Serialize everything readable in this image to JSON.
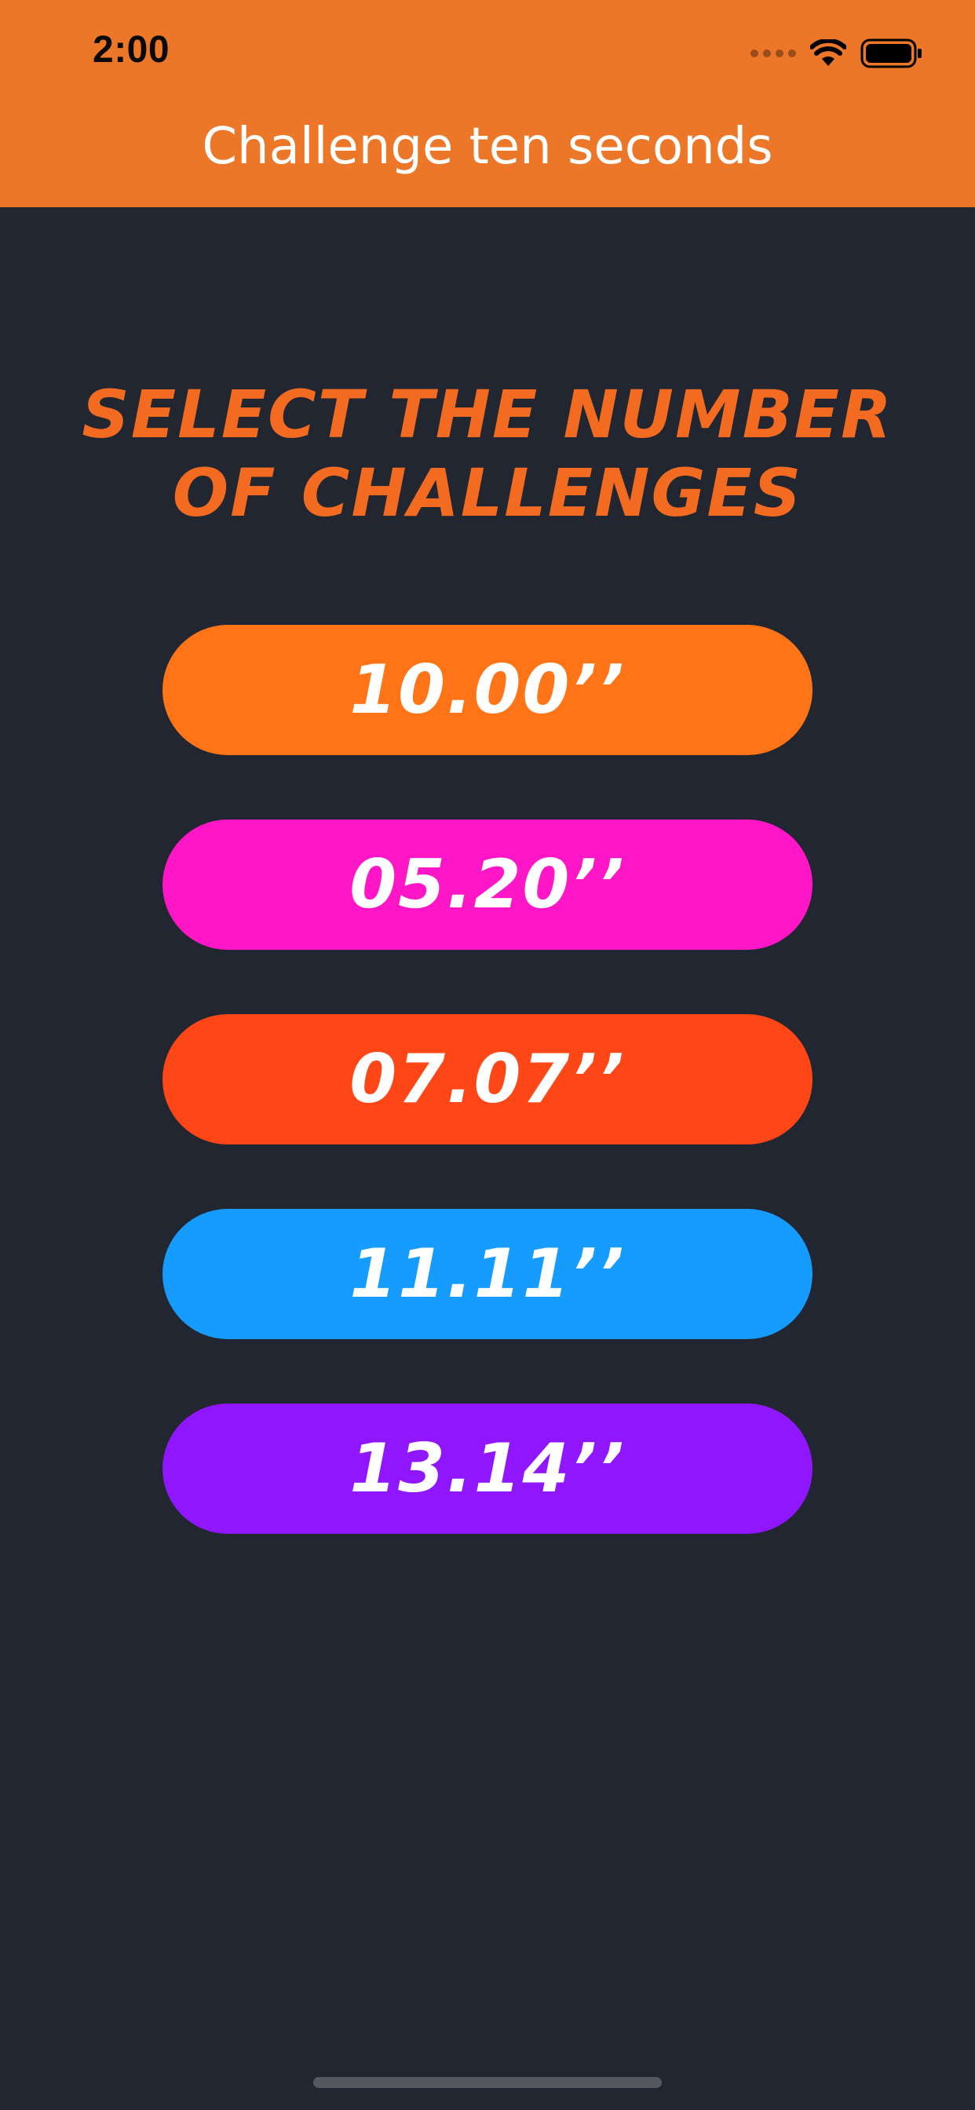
{
  "status_bar": {
    "time": "2:00"
  },
  "nav": {
    "title": "Challenge ten seconds"
  },
  "headline": {
    "line1": "SELECT THE NUMBER",
    "line2": "OF CHALLENGES"
  },
  "options": [
    {
      "label": "10.00’’",
      "color": "#FF7417"
    },
    {
      "label": "05.20’’",
      "color": "#FF16C6"
    },
    {
      "label": "07.07’’",
      "color": "#FF4617"
    },
    {
      "label": "11.11’’",
      "color": "#169BFF"
    },
    {
      "label": "13.14’’",
      "color": "#9016FF"
    }
  ],
  "theme": {
    "header_color": "#ED7728",
    "background_color": "#212630",
    "headline_color": "#F26B21"
  },
  "icons": [
    "signal-dots-icon",
    "wifi-icon",
    "battery-icon"
  ]
}
